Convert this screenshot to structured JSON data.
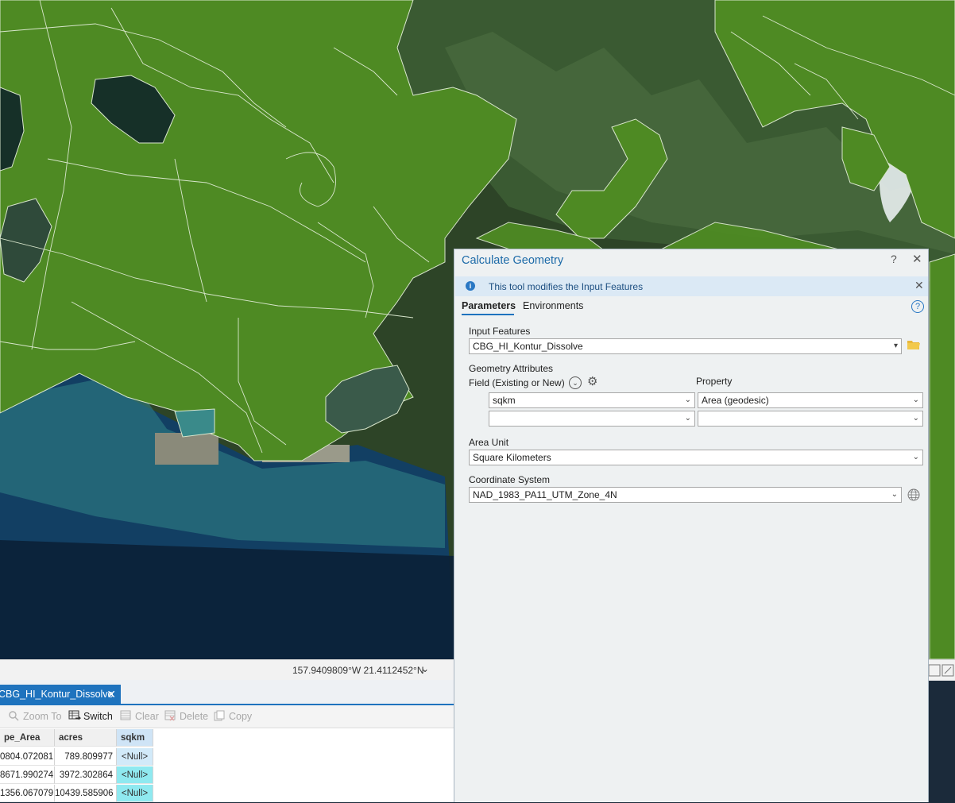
{
  "map": {
    "coordinates": "157.9409809°W 21.4112452°N"
  },
  "attribute_table": {
    "tab_title": "CBG_HI_Kontur_Dissolve",
    "toolbar": {
      "zoom_to": "Zoom To",
      "switch": "Switch",
      "clear": "Clear",
      "delete": "Delete",
      "copy": "Copy"
    },
    "columns": [
      "pe_Area",
      "acres",
      "sqkm"
    ],
    "rows": [
      [
        "0804.072081",
        "789.809977",
        "<Null>"
      ],
      [
        "8671.990274",
        "3972.302864",
        "<Null>"
      ],
      [
        "1356.067079",
        "10439.585906",
        "<Null>"
      ]
    ]
  },
  "geoprocessing": {
    "title": "Calculate Geometry",
    "help": "?",
    "close": "✕",
    "info_message": "This tool modifies the Input Features",
    "tabs": {
      "parameters": "Parameters",
      "environments": "Environments"
    },
    "input_features": {
      "label": "Input Features",
      "value": "CBG_HI_Kontur_Dissolve"
    },
    "geometry_attributes": {
      "label": "Geometry Attributes",
      "field_header": "Field (Existing or New)",
      "property_header": "Property",
      "rows": [
        {
          "field": "sqkm",
          "property": "Area (geodesic)"
        },
        {
          "field": "",
          "property": ""
        }
      ]
    },
    "area_unit": {
      "label": "Area Unit",
      "value": "Square Kilometers"
    },
    "coordinate_system": {
      "label": "Coordinate System",
      "value": "NAD_1983_PA11_UTM_Zone_4N"
    }
  },
  "colors": {
    "polygon_fill": "#4e8a23",
    "accent": "#1e73be",
    "info_bar": "#dbe9f5"
  }
}
